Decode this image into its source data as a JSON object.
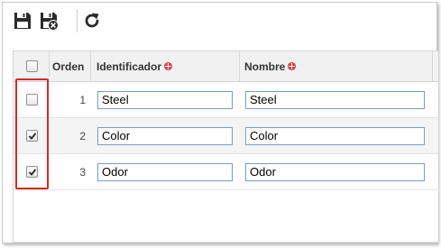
{
  "toolbar": {
    "save_icon": "floppy-disk-icon",
    "save_close_icon": "floppy-disk-close-icon",
    "refresh_icon": "refresh-icon"
  },
  "grid": {
    "columns": {
      "select_all_checked": false,
      "order": "Orden",
      "identifier": "Identificador",
      "name": "Nombre"
    },
    "rows": [
      {
        "order": "1",
        "identifier": "Steel",
        "name": "Steel",
        "checked": false
      },
      {
        "order": "2",
        "identifier": "Color",
        "name": "Color",
        "checked": true
      },
      {
        "order": "3",
        "identifier": "Odor",
        "name": "Odor",
        "checked": true
      }
    ]
  },
  "colors": {
    "highlight_border": "#d42a2a",
    "required_marker": "#e23b3b",
    "input_border": "#7a9cc0"
  }
}
